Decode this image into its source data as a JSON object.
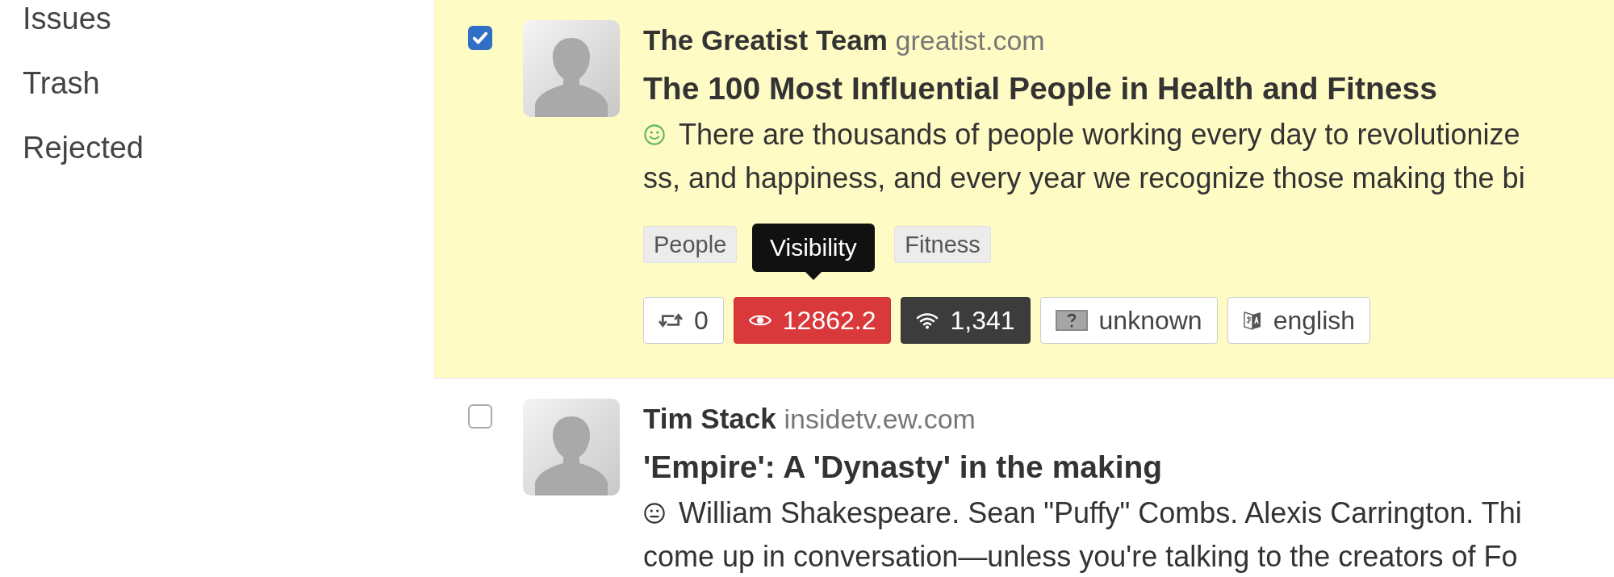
{
  "sidebar": {
    "items": [
      {
        "label": "Issues"
      },
      {
        "label": "Trash"
      },
      {
        "label": "Rejected"
      }
    ]
  },
  "items": [
    {
      "checked": true,
      "author": "The Greatist Team",
      "domain": "greatist.com",
      "title": "The 100 Most Influential People in Health and Fitness",
      "kind": "positive",
      "summary_lines": [
        "There are thousands of people working every day to revolutionize",
        "ss, and happiness, and every year we recognize those making the bi"
      ],
      "tags": [
        "People",
        "Fitness"
      ],
      "tooltip": "Visibility",
      "badges": [
        {
          "kind": "shares",
          "text": "0"
        },
        {
          "kind": "visibility",
          "text": "12862.2"
        },
        {
          "kind": "reach",
          "text": "1,341"
        },
        {
          "kind": "unknown",
          "text": "unknown"
        },
        {
          "kind": "language",
          "text": "english"
        }
      ]
    },
    {
      "checked": false,
      "author": "Tim Stack",
      "domain": "insidetv.ew.com",
      "title": "'Empire': A 'Dynasty' in the making",
      "kind": "neutral",
      "summary_lines": [
        "William Shakespeare. Sean \"Puffy\" Combs. Alexis Carrington. Thi",
        "come up in conversation—unless you're talking to the creators of Fo"
      ]
    }
  ]
}
